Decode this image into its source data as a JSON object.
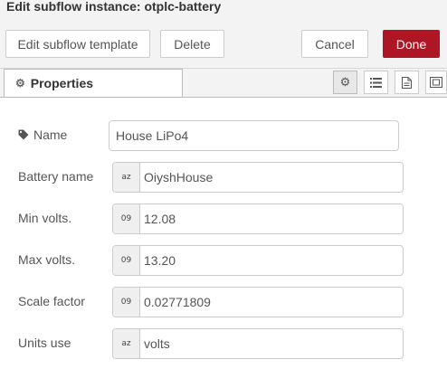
{
  "dialog": {
    "title": "Edit subflow instance: otplc-battery"
  },
  "toolbar": {
    "edit_template_label": "Edit subflow template",
    "delete_label": "Delete",
    "cancel_label": "Cancel",
    "done_label": "Done",
    "done_color": "#ad1625"
  },
  "tabs": {
    "properties_label": "Properties",
    "properties_icon": "gear-icon",
    "side_icons": [
      "gear-icon",
      "list-icon",
      "document-icon",
      "frame-icon"
    ]
  },
  "form": {
    "name": {
      "label": "Name",
      "value": "House LiPo4",
      "icon": "tag-icon"
    },
    "fields": [
      {
        "label": "Battery name",
        "type_glyph": "az",
        "type_icon": "string-type-icon",
        "value": "OiyshHouse"
      },
      {
        "label": "Min volts.",
        "type_glyph": "09",
        "type_icon": "number-type-icon",
        "value": "12.08"
      },
      {
        "label": "Max volts.",
        "type_glyph": "09",
        "type_icon": "number-type-icon",
        "value": "13.20"
      },
      {
        "label": "Scale factor",
        "type_glyph": "09",
        "type_icon": "number-type-icon",
        "value": "0.02771809"
      },
      {
        "label": "Units use",
        "type_glyph": "az",
        "type_icon": "string-type-icon",
        "value": "volts"
      }
    ]
  }
}
